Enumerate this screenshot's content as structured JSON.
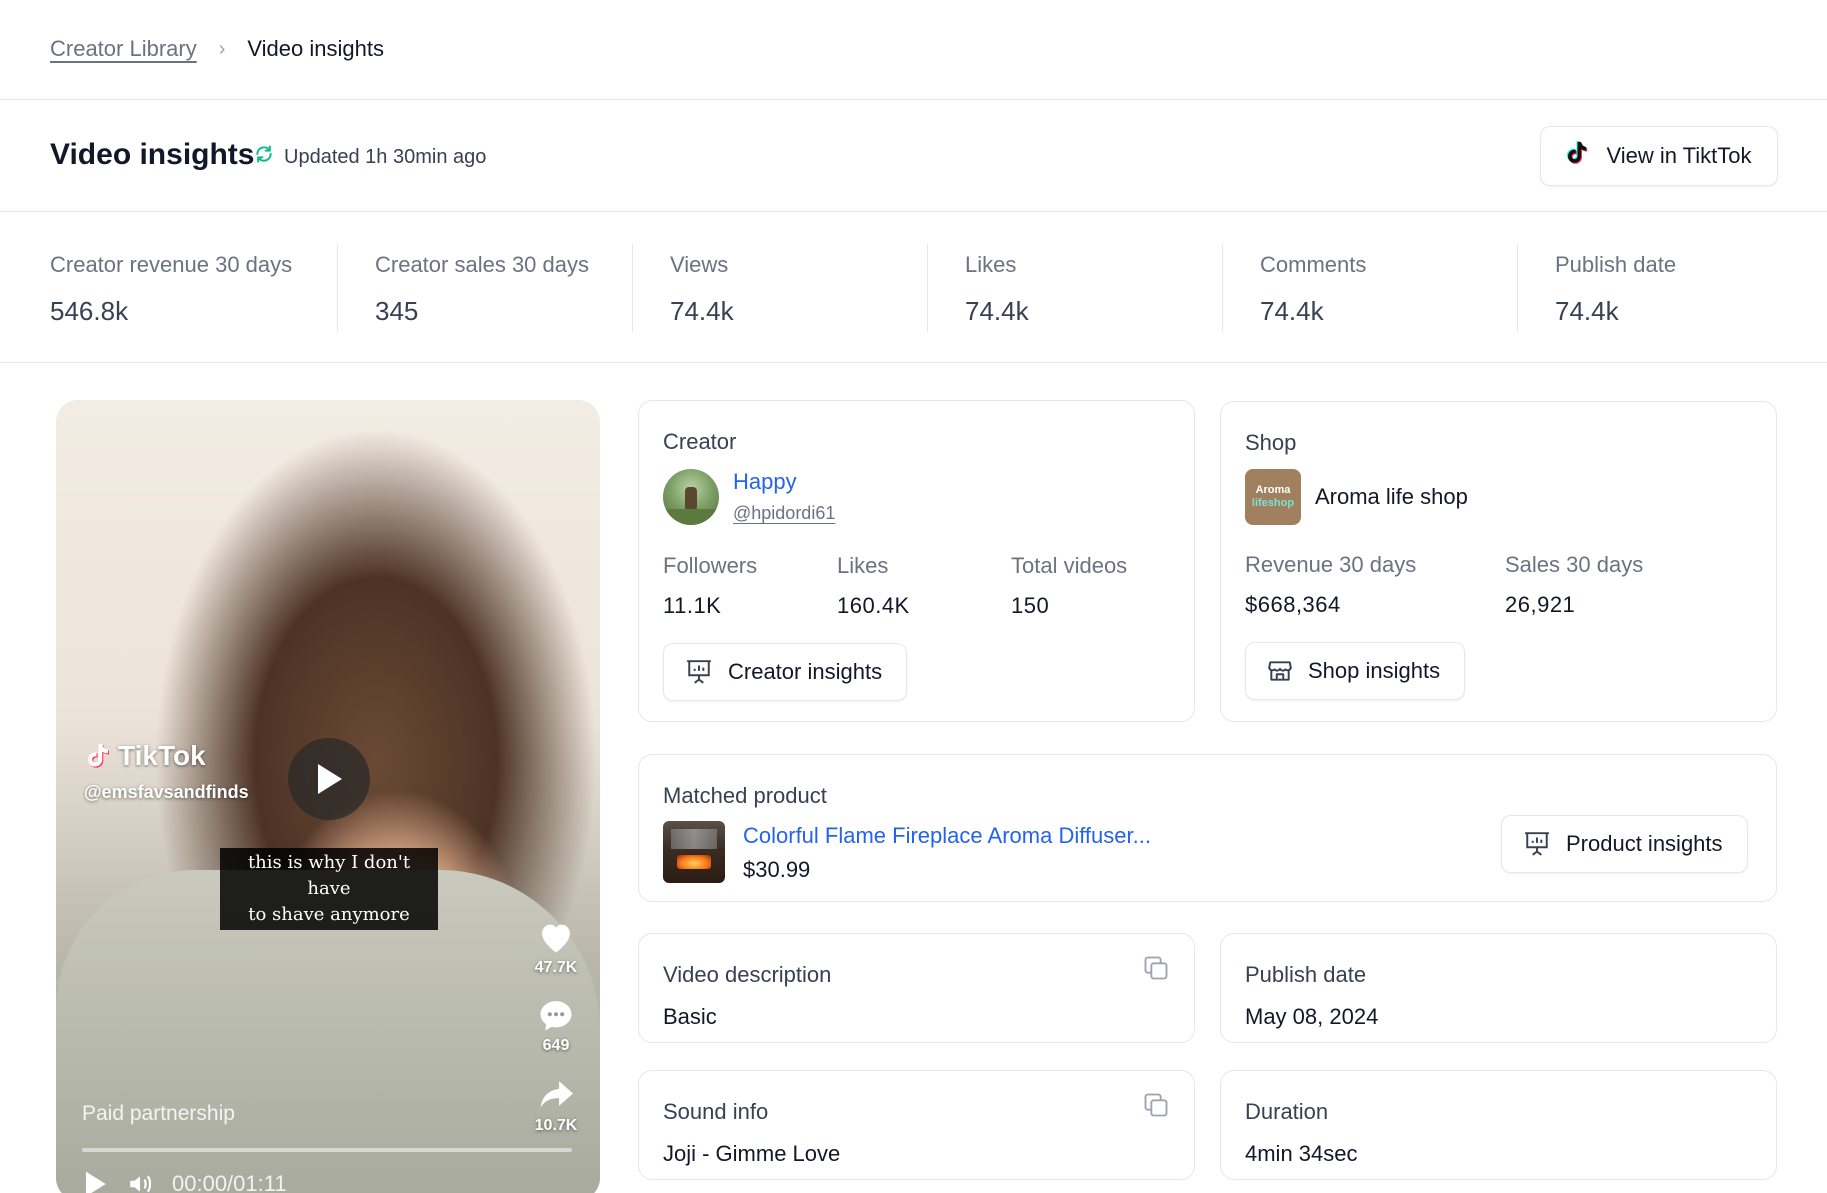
{
  "breadcrumb": {
    "parent": "Creator Library",
    "current": "Video insights"
  },
  "header": {
    "title": "Video insights",
    "updated": "Updated 1h 30min ago",
    "tiktok_button": "View in TiktTok"
  },
  "stats": [
    {
      "label": "Creator revenue 30 days",
      "value": "546.8k"
    },
    {
      "label": "Creator sales 30 days",
      "value": "345"
    },
    {
      "label": "Views",
      "value": "74.4k"
    },
    {
      "label": "Likes",
      "value": "74.4k"
    },
    {
      "label": "Comments",
      "value": "74.4k"
    },
    {
      "label": "Publish date",
      "value": "74.4k"
    }
  ],
  "video": {
    "brand": "TikTok",
    "handle": "@emsfavsandfinds",
    "caption_line1": "this is why I don't have",
    "caption_line2": "to shave anymore",
    "likes": "47.7K",
    "comments": "649",
    "shares": "10.7K",
    "paid_label": "Paid partnership",
    "time": "00:00/01:11"
  },
  "creator": {
    "title": "Creator",
    "name": "Happy",
    "handle": "@hpidordi61",
    "followers_label": "Followers",
    "followers": "11.1K",
    "likes_label": "Likes",
    "likes": "160.4K",
    "videos_label": "Total videos",
    "videos": "150",
    "button": "Creator insights"
  },
  "shop": {
    "title": "Shop",
    "name": "Aroma life shop",
    "logo_top": "Aroma",
    "logo_bottom": "lifeshop",
    "revenue_label": "Revenue 30 days",
    "revenue": "$668,364",
    "sales_label": "Sales 30 days",
    "sales": "26,921",
    "button": "Shop insights"
  },
  "product": {
    "title": "Matched product",
    "name": "Colorful Flame Fireplace Aroma Diffuser...",
    "price": "$30.99",
    "button": "Product insights"
  },
  "description": {
    "title": "Video description",
    "value": "Basic"
  },
  "publish": {
    "title": "Publish date",
    "value": "May 08, 2024"
  },
  "sound": {
    "title": "Sound info",
    "value": "Joji - Gimme Love"
  },
  "duration": {
    "title": "Duration",
    "value": "4min 34sec"
  },
  "colors": {
    "accent_link": "#2563eb",
    "refresh_icon": "#10b981",
    "border": "#e5e7eb"
  },
  "icons": [
    "chevron-right-icon",
    "refresh-icon",
    "tiktok-icon",
    "presentation-chart-icon",
    "storefront-icon",
    "copy-icon",
    "play-icon",
    "heart-icon",
    "comment-icon",
    "share-icon",
    "volume-icon"
  ]
}
